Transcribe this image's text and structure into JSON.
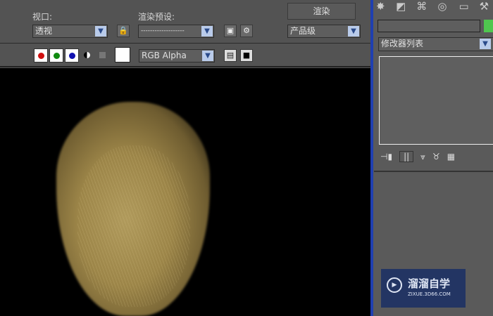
{
  "toolbar": {
    "viewport_label": "视口:",
    "viewport_value": "透视",
    "preset_label": "渲染预设:",
    "preset_value": "-------------------",
    "render_button": "渲染",
    "quality_value": "产品级",
    "channel_value": "RGB Alpha"
  },
  "side_panel": {
    "modifier_list": "修改器列表"
  },
  "watermark": {
    "brand": "溜溜自学",
    "url": "ZIXUE.3D66.COM"
  },
  "colors": {
    "accent_blue": "#1f3fb0",
    "green_swatch": "#4fc74f"
  }
}
